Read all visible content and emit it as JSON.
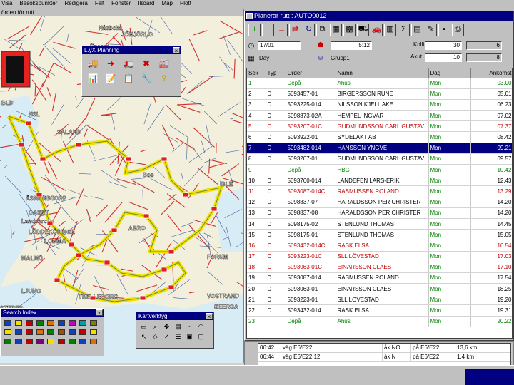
{
  "menu": [
    "Visa",
    "Besökspunkter",
    "Redigera",
    "Fält",
    "Fönster",
    "Ißoard",
    "Map",
    "Plott"
  ],
  "map_window": {
    "title": "örden för rutt"
  },
  "lx_palette": {
    "title": "L.yX Planning",
    "close": "×"
  },
  "search_palette": {
    "title": "Search Index",
    "close": "×"
  },
  "kartverktyg": {
    "title": "Kartverktyg",
    "close": "×"
  },
  "planner": {
    "title": "Planerar rutt : AUTO0012",
    "fields": {
      "date": "17/01",
      "time": "5:12",
      "day_label": "Day",
      "group": "Grupp1",
      "kollit_label": "Kolli",
      "kollit_value": "30",
      "kollit_count": "6",
      "akut_label": "Akut",
      "akut_value": "10",
      "akut_count": "8"
    },
    "headers": [
      "Sek",
      "Typ",
      "Order",
      "Namn",
      "Dag",
      "Ankomst"
    ],
    "rows": [
      {
        "sek": "1",
        "typ": "",
        "order": "Depå",
        "namn": "Ahus",
        "dag": "Mon",
        "ank": "03.00",
        "color": "#008000"
      },
      {
        "sek": "2",
        "typ": "D",
        "order": "5093457-01",
        "namn": "BIRGERSSON RUNE",
        "dag": "Mon",
        "ank": "05.01",
        "color": "#000000"
      },
      {
        "sek": "3",
        "typ": "D",
        "order": "5093225-014",
        "namn": "NILSSON KJELL AKE",
        "dag": "Mon",
        "ank": "06.23",
        "color": "#000000"
      },
      {
        "sek": "4",
        "typ": "D",
        "order": "5098873-02A",
        "namn": "HEMPEL INGVAR",
        "dag": "Mon",
        "ank": "07.02",
        "color": "#000000"
      },
      {
        "sek": "5",
        "typ": "C",
        "order": "5093207-01C",
        "namn": "GUDMUNDSSON CARL GUSTAV",
        "dag": "Mon",
        "ank": "07.37",
        "color": "#c00000"
      },
      {
        "sek": "6",
        "typ": "D",
        "order": "5093922-01",
        "namn": "SYDELAKT AB",
        "dag": "Mon",
        "ank": "08.42",
        "color": "#000000"
      },
      {
        "sek": "7",
        "typ": "D",
        "order": "5093482-014",
        "namn": "HANSSON YNGVE",
        "dag": "Mon",
        "ank": "09.21",
        "color": "#ffffff",
        "selected": true
      },
      {
        "sek": "8",
        "typ": "D",
        "order": "5093207-01",
        "namn": "GUDMUNDSSON CARL GUSTAV",
        "dag": "Mon",
        "ank": "09.57",
        "color": "#000000"
      },
      {
        "sek": "9",
        "typ": "",
        "order": "Depå",
        "namn": "HBG",
        "dag": "Mon",
        "ank": "10.42",
        "color": "#008000"
      },
      {
        "sek": "10",
        "typ": "D",
        "order": "5093760-014",
        "namn": "LANDEFEN LARS-ERIK",
        "dag": "Mon",
        "ank": "12.43",
        "color": "#000000"
      },
      {
        "sek": "11",
        "typ": "C",
        "order": "5093087-014C",
        "namn": "RASMUSSEN ROLAND",
        "dag": "Mon",
        "ank": "13.29",
        "color": "#c00000"
      },
      {
        "sek": "12",
        "typ": "D",
        "order": "5098837-07",
        "namn": "HARALDSSON PER CHRISTER",
        "dag": "Mon",
        "ank": "14.20",
        "color": "#000000"
      },
      {
        "sek": "13",
        "typ": "D",
        "order": "5098837-08",
        "namn": "HARALDSSON PER CHRISTER",
        "dag": "Mon",
        "ank": "14.20",
        "color": "#000000"
      },
      {
        "sek": "14",
        "typ": "D",
        "order": "5098175-02",
        "namn": "STENLUND THOMAS",
        "dag": "Mon",
        "ank": "14.45",
        "color": "#000000"
      },
      {
        "sek": "15",
        "typ": "D",
        "order": "5098175-01",
        "namn": "STENLUND THOMAS",
        "dag": "Mon",
        "ank": "15.05",
        "color": "#000000"
      },
      {
        "sek": "16",
        "typ": "C",
        "order": "5093432-014C",
        "namn": "RASK ELSA",
        "dag": "Mon",
        "ank": "16.54",
        "color": "#c00000"
      },
      {
        "sek": "17",
        "typ": "C",
        "order": "5093223-01C",
        "namn": "SLL LÖVESTAD",
        "dag": "Mon",
        "ank": "17.03",
        "color": "#c00000"
      },
      {
        "sek": "18",
        "typ": "C",
        "order": "5093063-01C",
        "namn": "EINARSSON CLAES",
        "dag": "Mon",
        "ank": "17.10",
        "color": "#c00000"
      },
      {
        "sek": "19",
        "typ": "D",
        "order": "5093087-014",
        "namn": "RASMUSSEN ROLAND",
        "dag": "Mon",
        "ank": "17.54",
        "color": "#000000"
      },
      {
        "sek": "20",
        "typ": "D",
        "order": "5093063-01",
        "namn": "EINARSSON CLAES",
        "dag": "Mon",
        "ank": "18.25",
        "color": "#000000"
      },
      {
        "sek": "21",
        "typ": "D",
        "order": "5093223-01",
        "namn": "SLL LÖVESTAD",
        "dag": "Mon",
        "ank": "19.20",
        "color": "#000000"
      },
      {
        "sek": "22",
        "typ": "D",
        "order": "5093432-014",
        "namn": "RASK ELSA",
        "dag": "Mon",
        "ank": "19.31",
        "color": "#000000"
      },
      {
        "sek": "23",
        "typ": "",
        "order": "Depå",
        "namn": "Ahus",
        "dag": "Mon",
        "ank": "20.22",
        "color": "#008000"
      }
    ]
  },
  "log": [
    {
      "t": "06:42",
      "route": "väg E6/E22",
      "dir": "åk NO",
      "road": "på E6/E22",
      "dist": "13,6 km"
    },
    {
      "t": "06:44",
      "route": "väg E6/E22 12",
      "dir": "åk N",
      "road": "på E6/E22",
      "dist": "1,4 km"
    }
  ],
  "map_labels": [
    "Nåsboka",
    "Enered",
    "BLD",
    "NSL",
    "JÖNJÖRLO",
    "SALAND",
    "Boo",
    "BLE",
    "ÅSMUNDTORP",
    "DAGST",
    "Landskrona",
    "LÖDDEKÖPINGE",
    "LOMMA",
    "MALMÖ",
    "LJUNG",
    "TRELLEBORG",
    "STERED",
    "ABRO",
    "VOSTRAND",
    "SEERGA",
    "FORUM"
  ]
}
